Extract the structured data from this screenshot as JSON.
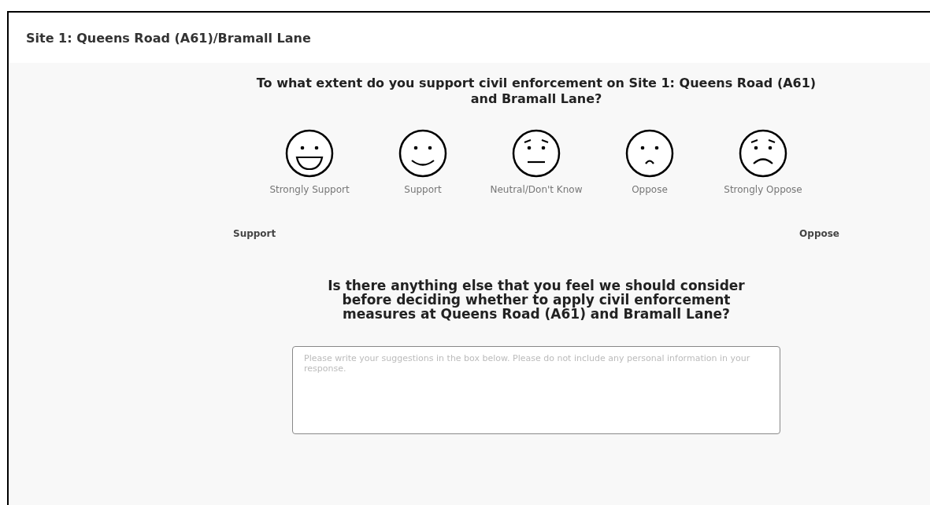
{
  "section": {
    "title": "Site 1: Queens Road (A61)/Bramall Lane"
  },
  "question_1": {
    "text": "To what extent do you support civil enforcement on Site 1: Queens Road (A61) and Bramall Lane?",
    "options": [
      {
        "kind": "big-smile",
        "label": "Strongly Support",
        "selected": false
      },
      {
        "kind": "smile",
        "label": "Support",
        "selected": false
      },
      {
        "kind": "neutral",
        "label": "Neutral/Don't Know",
        "selected": false
      },
      {
        "kind": "frown",
        "label": "Oppose",
        "selected": false
      },
      {
        "kind": "big-frown",
        "label": "Strongly Oppose",
        "selected": false
      }
    ],
    "scale_left": "Support",
    "scale_right": "Oppose"
  },
  "question_2": {
    "text": "Is there anything else that you feel we should consider before deciding whether to apply civil enforcement measures at Queens Road (A61) and Bramall Lane?",
    "placeholder": "Please write your suggestions in the box below. Please do not include any personal information in your response."
  }
}
